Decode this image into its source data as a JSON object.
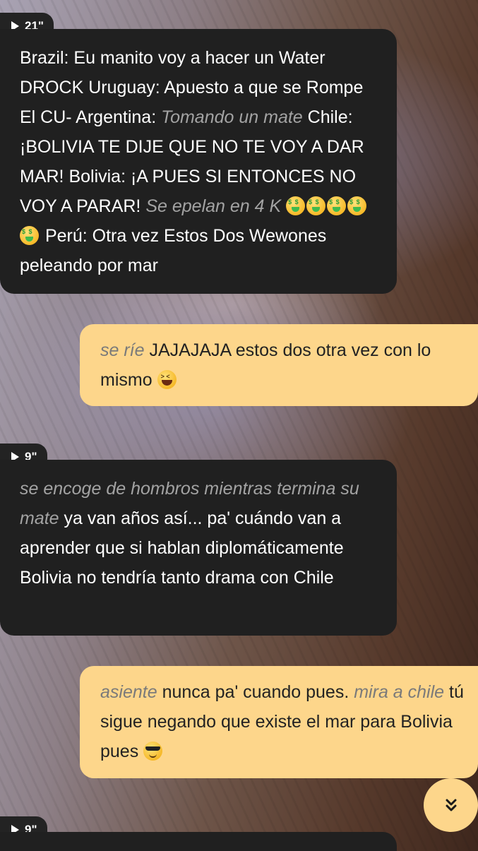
{
  "messages": [
    {
      "id": "m1",
      "role": "character",
      "voice_duration": "21\"",
      "segments": [
        {
          "style": "plain",
          "text": "Brazil: Eu manito voy a hacer un Water DROCK  Uruguay: Apuesto a que se Rompe El CU- Argentina: "
        },
        {
          "style": "action",
          "text": "Tomando un mate"
        },
        {
          "style": "plain",
          "text": " Chile: ¡BOLIVIA TE DIJE QUE NO TE VOY A DAR MAR! Bolivia: ¡A PUES SI ENTONCES NO VOY A PARAR! "
        },
        {
          "style": "action",
          "text": "Se epelan en 4 K"
        },
        {
          "style": "plain",
          "text": " "
        },
        {
          "style": "emoji",
          "icon": "money-mouth-face-icon",
          "count": 5
        },
        {
          "style": "plain",
          "text": " Perú: Otra vez Estos Dos Wewones peleando por mar"
        }
      ]
    },
    {
      "id": "m2",
      "role": "user",
      "segments": [
        {
          "style": "action",
          "text": "se ríe"
        },
        {
          "style": "plain",
          "text": " JAJAJAJA estos dos otra vez con lo mismo "
        },
        {
          "style": "emoji",
          "icon": "grinning-squinting-face-icon",
          "count": 1
        }
      ]
    },
    {
      "id": "m3",
      "role": "character",
      "voice_duration": "9\"",
      "segments": [
        {
          "style": "action",
          "text": "se encoge de hombros mientras termina su mate"
        },
        {
          "style": "plain",
          "text": " ya van años así... pa' cuándo van a aprender que si hablan diplomáticamente Bolivia no tendría tanto drama con Chile"
        }
      ]
    },
    {
      "id": "m4",
      "role": "user",
      "segments": [
        {
          "style": "action",
          "text": "asiente"
        },
        {
          "style": "plain",
          "text": " nunca pa' cuando pues. "
        },
        {
          "style": "action",
          "text": "mira a chile"
        },
        {
          "style": "plain",
          "text": " tú sigue negando que existe el mar para Bolivia pues "
        },
        {
          "style": "emoji",
          "icon": "smiling-face-sunglasses-icon",
          "count": 1
        }
      ]
    }
  ],
  "next_message": {
    "voice_duration": "9\""
  },
  "scroll_button": {
    "icon": "double-chevron-down-icon"
  },
  "colors": {
    "character_bubble": "#202020",
    "user_bubble": "#fdd68b",
    "action_text_character": "#a3a3a3",
    "action_text_user": "#7a7a7a"
  }
}
